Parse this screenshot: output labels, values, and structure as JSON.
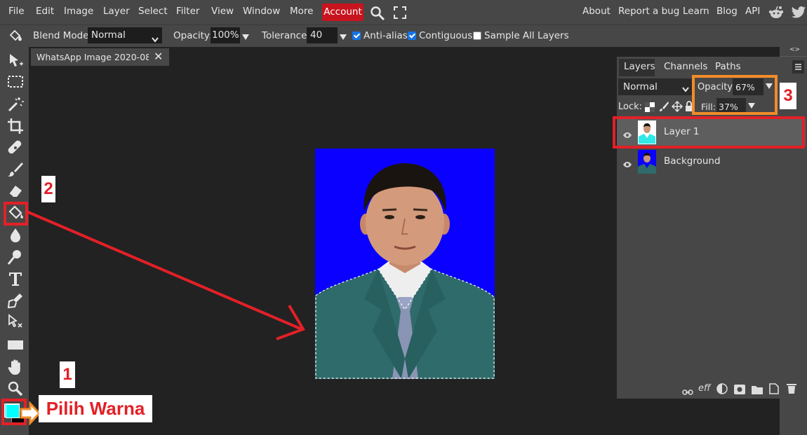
{
  "menu": {
    "items": [
      "File",
      "Edit",
      "Image",
      "Layer",
      "Select",
      "Filter",
      "View",
      "Window",
      "More"
    ],
    "account": "Account",
    "right_links": [
      "About",
      "Report a bug",
      "Learn",
      "Blog",
      "API"
    ]
  },
  "options": {
    "blend_label": "Blend Mode:",
    "blend_value": "Normal",
    "opacity_label": "Opacity:",
    "opacity_value": "100%",
    "tolerance_label": "Tolerance:",
    "tolerance_value": "40",
    "antialias_label": "Anti-alias",
    "antialias_checked": true,
    "contiguous_label": "Contiguous",
    "contiguous_checked": true,
    "sample_label": "Sample All Layers",
    "sample_checked": false
  },
  "document_tab": {
    "title": "WhatsApp Image 2020-08-"
  },
  "layers_panel": {
    "tabs": [
      "Layers",
      "Channels",
      "Paths"
    ],
    "blend_mode": "Normal",
    "opacity_label": "Opacity:",
    "opacity_value": "67%",
    "lock_label": "Lock:",
    "fill_label": "Fill:",
    "fill_value": "37%",
    "layers": [
      {
        "name": "Layer 1",
        "selected": true
      },
      {
        "name": "Background",
        "selected": false
      }
    ],
    "footer_fx": "eff"
  },
  "annotations": {
    "step1": "1",
    "step2": "2",
    "step3": "3",
    "pick_color": "Pilih Warna"
  },
  "colors": {
    "accent": "#c8141e",
    "annotation_red": "#e32027",
    "annotation_orange": "#f28c28",
    "foreground_color": "#00ffff",
    "canvas_background": "#0a00ff"
  },
  "icons": [
    "move",
    "marquee",
    "magic-wand",
    "crop",
    "healing",
    "brush",
    "eraser",
    "paint-bucket",
    "blur",
    "dodge",
    "text",
    "pen",
    "path-select",
    "rectangle",
    "hand",
    "zoom"
  ]
}
